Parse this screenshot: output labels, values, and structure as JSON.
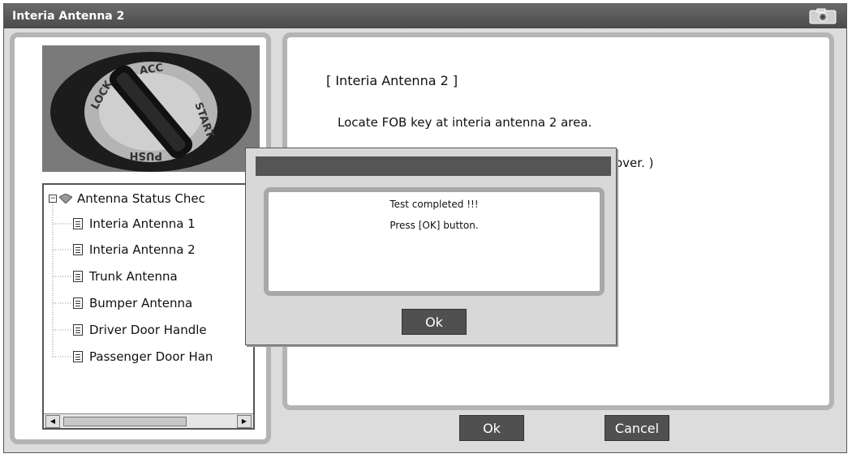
{
  "window": {
    "title": "Interia Antenna 2"
  },
  "tree": {
    "root_label": "Antenna Status Chec",
    "items": [
      {
        "label": "Interia Antenna 1"
      },
      {
        "label": "Interia Antenna 2"
      },
      {
        "label": "Trunk Antenna"
      },
      {
        "label": "Bumper Antenna"
      },
      {
        "label": "Driver Door Handle"
      },
      {
        "label": "Passenger Door Han"
      }
    ]
  },
  "main": {
    "heading": "[ Interia Antenna 2 ]",
    "instruction": "Locate FOB key at interia antenna 2 area.",
    "partial_line": "over. )"
  },
  "buttons": {
    "ok": "Ok",
    "cancel": "Cancel"
  },
  "dialog": {
    "message_1": "Test completed !!!",
    "message_2": "Press [OK] button.",
    "ok_label": "Ok"
  },
  "photo": {
    "ring_labels": [
      "LOCK",
      "ACC",
      "START",
      "PUSH"
    ]
  },
  "colors": {
    "titlebar": "#4a4a4a",
    "button": "#505050",
    "panel_border": "#b4b4b4"
  }
}
